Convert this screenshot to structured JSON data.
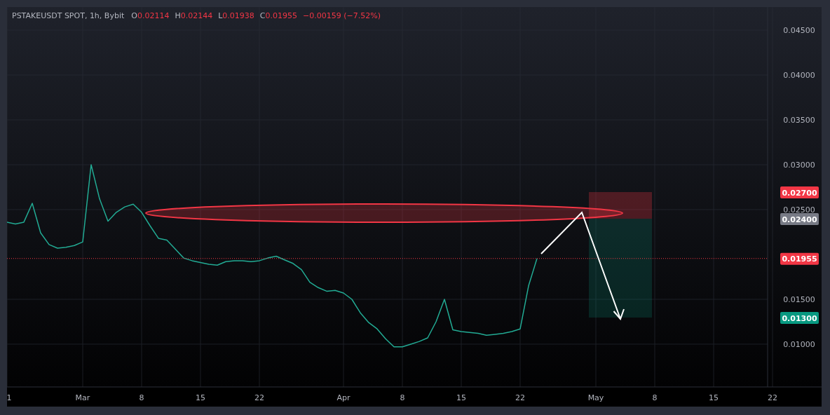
{
  "legend": {
    "symbol": "PSTAKEUSDT SPOT, 1h, Bybit",
    "ohlc": [
      {
        "key": "O",
        "value": "0.02114"
      },
      {
        "key": "H",
        "value": "0.02144"
      },
      {
        "key": "L",
        "value": "0.01938"
      },
      {
        "key": "C",
        "value": "0.01955"
      }
    ],
    "change": "−0.00159 (−7.52%)"
  },
  "chart_data": {
    "type": "line",
    "grid": true,
    "ylim": [
      0.00523,
      0.04758
    ],
    "categories": [
      "1",
      null,
      null,
      null,
      null,
      null,
      null,
      null,
      null,
      "Mar",
      null,
      null,
      null,
      null,
      null,
      null,
      "8",
      null,
      null,
      null,
      null,
      null,
      null,
      "15",
      null,
      null,
      null,
      null,
      null,
      null,
      "22",
      null,
      null,
      null,
      null,
      null,
      null,
      null,
      null,
      null,
      "Apr",
      null,
      null,
      null,
      null,
      null,
      null,
      "8",
      null,
      null,
      null,
      null,
      null,
      null,
      "15",
      null,
      null,
      null,
      null,
      null,
      null,
      "22",
      null,
      null,
      null,
      null,
      null,
      null,
      null,
      null,
      "May",
      null,
      null,
      null,
      null,
      null,
      null,
      "8",
      null,
      null,
      null,
      null,
      null,
      null,
      "15",
      null,
      null,
      null,
      null,
      null,
      null,
      "22"
    ],
    "series": [
      {
        "color": "#22ab94",
        "values": [
          0.0236,
          0.0234,
          0.0236,
          0.0257,
          0.0224,
          0.0211,
          0.0207,
          0.0208,
          0.021,
          0.0214,
          0.03,
          0.0262,
          0.0237,
          0.0247,
          0.0253,
          0.0256,
          0.0247,
          0.0232,
          0.0218,
          0.0216,
          0.0206,
          0.0196,
          0.0193,
          0.0191,
          0.0189,
          0.0188,
          0.0192,
          0.0193,
          0.0193,
          0.0192,
          0.0193,
          0.0196,
          0.0198,
          0.0194,
          0.019,
          0.0183,
          0.0169,
          0.0163,
          0.0159,
          0.016,
          0.0157,
          0.015,
          0.0135,
          0.0124,
          0.0117,
          0.0106,
          0.0097,
          0.0097,
          0.01,
          0.0103,
          0.0107,
          0.0125,
          0.015,
          0.0116,
          0.0114,
          0.0113,
          0.0112,
          0.011,
          0.0111,
          0.0112,
          0.0114,
          0.0117,
          0.0165,
          0.01955,
          null,
          null,
          null,
          null,
          null,
          null,
          null,
          null,
          null,
          null,
          null,
          null,
          null,
          null,
          null,
          null,
          null,
          null,
          null,
          null,
          null,
          null,
          null,
          null,
          null,
          null,
          null,
          null
        ]
      }
    ],
    "yticks": [
      {
        "value": 0.045,
        "label": "0.04500"
      },
      {
        "value": 0.04,
        "label": "0.04000"
      },
      {
        "value": 0.035,
        "label": "0.03500"
      },
      {
        "value": 0.03,
        "label": "0.03000"
      },
      {
        "value": 0.025,
        "label": "0.02500"
      },
      {
        "value": 0.015,
        "label": "0.01500"
      },
      {
        "value": 0.01,
        "label": "0.01000"
      }
    ],
    "ref_lines": [
      {
        "axis": "y",
        "value": 0.01955,
        "label": "0.01955",
        "color": "#f23645"
      }
    ]
  },
  "price_tags": [
    {
      "label": "0.02700",
      "color": "#f23645"
    },
    {
      "label": "0.02400",
      "color": "#787b86"
    },
    {
      "label": "0.01300",
      "color": "#089981"
    }
  ]
}
